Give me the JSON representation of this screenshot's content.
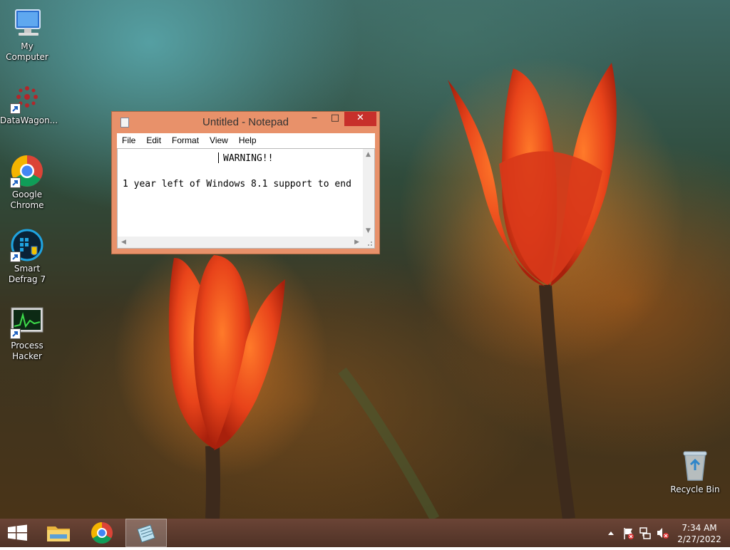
{
  "desktop": {
    "icons": [
      {
        "label": "My Computer",
        "icon": "computer-icon"
      },
      {
        "label": "DataWagon...",
        "icon": "datawagon-icon"
      },
      {
        "label": "Google Chrome",
        "icon": "chrome-icon"
      },
      {
        "label": "Smart Defrag 7",
        "icon": "smart-defrag-icon"
      },
      {
        "label": "Process Hacker",
        "icon": "process-hacker-icon"
      }
    ],
    "recycle_bin": {
      "label": "Recycle Bin",
      "icon": "recycle-bin-icon"
    }
  },
  "notepad": {
    "title": "Untitled - Notepad",
    "menu": [
      "File",
      "Edit",
      "Format",
      "View",
      "Help"
    ],
    "content": {
      "line1": "WARNING!!",
      "line2": "1 year left of Windows 8.1 support to end"
    },
    "controls": {
      "minimize": "‒",
      "maximize": "□",
      "close": "✕"
    }
  },
  "taskbar": {
    "start_icon": "windows-start-icon",
    "pinned": [
      "file-explorer-icon",
      "chrome-icon",
      "notepad-icon"
    ],
    "tray_icons": [
      "show-hidden-icons-icon",
      "action-center-flag-icon",
      "network-icon",
      "volume-muted-icon"
    ],
    "time": "7:34 AM",
    "date": "2/27/2022"
  },
  "colors": {
    "notepad_frame": "#e8916a",
    "close_button": "#c7302b",
    "taskbar": "#5a3a2c",
    "tulip": "#e8431a"
  }
}
